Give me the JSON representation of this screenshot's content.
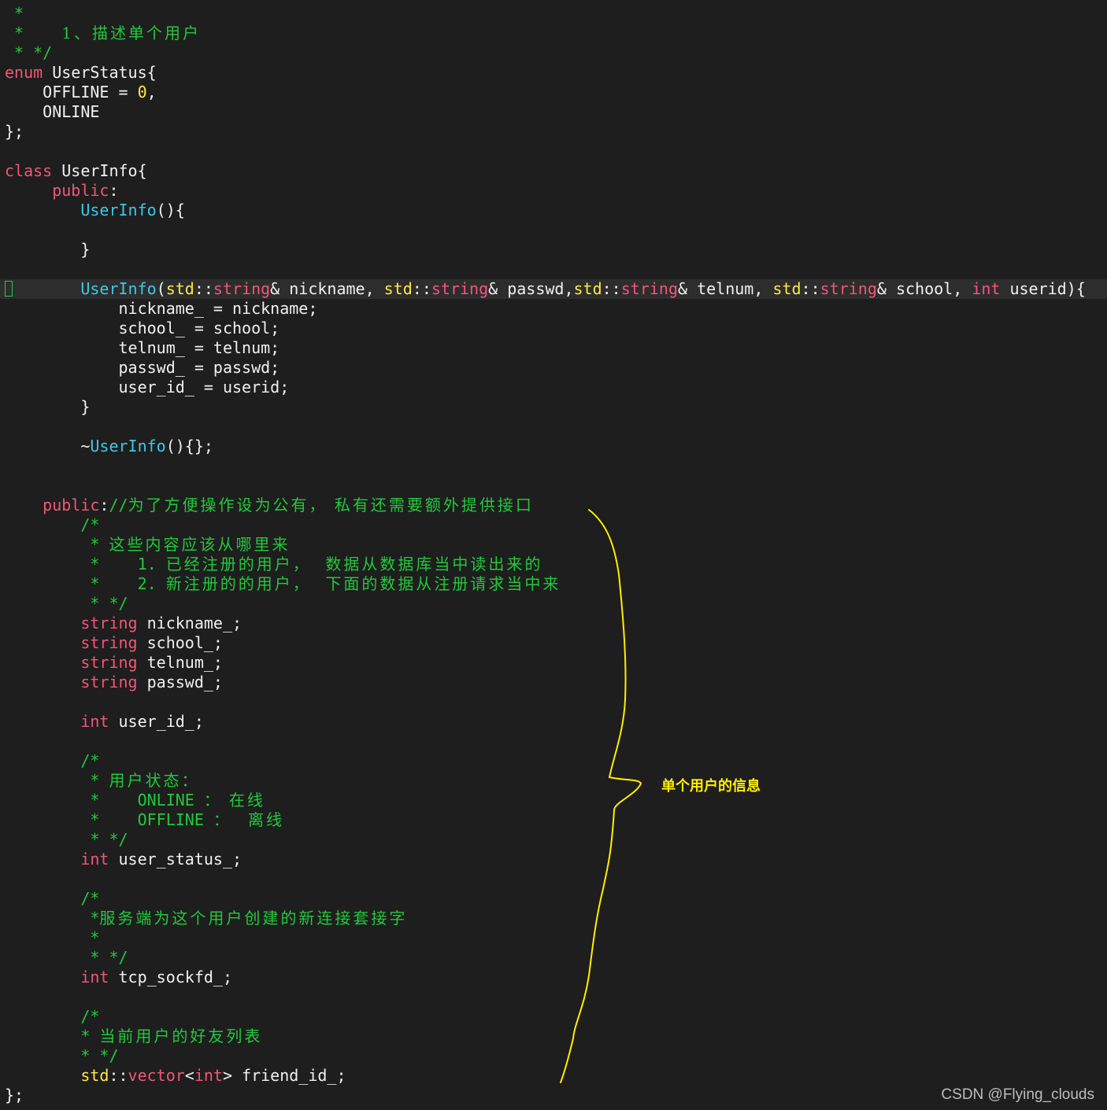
{
  "editor": {
    "lines": [
      {
        "tokens": [
          {
            "t": " *",
            "c": "cm"
          }
        ]
      },
      {
        "tokens": [
          {
            "t": " *    ",
            "c": "cm"
          },
          {
            "t": "1、描述单个用户",
            "c": "cm-cn"
          }
        ]
      },
      {
        "tokens": [
          {
            "t": " * */",
            "c": "cm"
          }
        ]
      },
      {
        "tokens": [
          {
            "t": "enum",
            "c": "kw"
          },
          {
            "t": " UserStatus{",
            "c": "plain"
          }
        ]
      },
      {
        "tokens": [
          {
            "t": "    OFFLINE = ",
            "c": "plain"
          },
          {
            "t": "0",
            "c": "num"
          },
          {
            "t": ",",
            "c": "plain"
          }
        ]
      },
      {
        "tokens": [
          {
            "t": "    ONLINE",
            "c": "plain"
          }
        ]
      },
      {
        "tokens": [
          {
            "t": "};",
            "c": "plain"
          }
        ]
      },
      {
        "tokens": []
      },
      {
        "tokens": [
          {
            "t": "class",
            "c": "kw"
          },
          {
            "t": " UserInfo{",
            "c": "plain"
          }
        ]
      },
      {
        "tokens": [
          {
            "t": "     ",
            "c": "plain"
          },
          {
            "t": "public",
            "c": "kw"
          },
          {
            "t": ":",
            "c": "plain"
          }
        ]
      },
      {
        "tokens": [
          {
            "t": "        ",
            "c": "plain"
          },
          {
            "t": "UserInfo",
            "c": "fn"
          },
          {
            "t": "(){",
            "c": "plain"
          }
        ]
      },
      {
        "tokens": []
      },
      {
        "tokens": [
          {
            "t": "        }",
            "c": "plain"
          }
        ]
      },
      {
        "tokens": []
      },
      {
        "cursor": true,
        "tokens": [
          {
            "t": "        ",
            "c": "plain"
          },
          {
            "t": "UserInfo",
            "c": "fn"
          },
          {
            "t": "(",
            "c": "plain"
          },
          {
            "t": "std",
            "c": "ns"
          },
          {
            "t": "::",
            "c": "plain"
          },
          {
            "t": "string",
            "c": "type"
          },
          {
            "t": "& nickname, ",
            "c": "plain"
          },
          {
            "t": "std",
            "c": "ns"
          },
          {
            "t": "::",
            "c": "plain"
          },
          {
            "t": "string",
            "c": "type"
          },
          {
            "t": "& passwd,",
            "c": "plain"
          },
          {
            "t": "std",
            "c": "ns"
          },
          {
            "t": "::",
            "c": "plain"
          },
          {
            "t": "string",
            "c": "type"
          },
          {
            "t": "& telnum, ",
            "c": "plain"
          },
          {
            "t": "std",
            "c": "ns"
          },
          {
            "t": "::",
            "c": "plain"
          },
          {
            "t": "string",
            "c": "type"
          },
          {
            "t": "& school, ",
            "c": "plain"
          },
          {
            "t": "int",
            "c": "kw"
          },
          {
            "t": " userid){",
            "c": "plain"
          }
        ]
      },
      {
        "tokens": [
          {
            "t": "            nickname_ = nickname;",
            "c": "plain"
          }
        ]
      },
      {
        "tokens": [
          {
            "t": "            school_ = school;",
            "c": "plain"
          }
        ]
      },
      {
        "tokens": [
          {
            "t": "            telnum_ = telnum;",
            "c": "plain"
          }
        ]
      },
      {
        "tokens": [
          {
            "t": "            passwd_ = passwd;",
            "c": "plain"
          }
        ]
      },
      {
        "tokens": [
          {
            "t": "            user_id_ = userid;",
            "c": "plain"
          }
        ]
      },
      {
        "tokens": [
          {
            "t": "        }",
            "c": "plain"
          }
        ]
      },
      {
        "tokens": []
      },
      {
        "tokens": [
          {
            "t": "        ~",
            "c": "plain"
          },
          {
            "t": "UserInfo",
            "c": "fn"
          },
          {
            "t": "(){};",
            "c": "plain"
          }
        ]
      },
      {
        "tokens": []
      },
      {
        "tokens": []
      },
      {
        "tokens": [
          {
            "t": "    ",
            "c": "plain"
          },
          {
            "t": "public",
            "c": "kw"
          },
          {
            "t": ":",
            "c": "plain"
          },
          {
            "t": "//",
            "c": "cm"
          },
          {
            "t": "为了方便操作设为公有， 私有还需要额外提供接口",
            "c": "cm-cn"
          }
        ]
      },
      {
        "tokens": [
          {
            "t": "        /*",
            "c": "cm"
          }
        ]
      },
      {
        "tokens": [
          {
            "t": "         * ",
            "c": "cm"
          },
          {
            "t": "这些内容应该从哪里来",
            "c": "cm-cn"
          }
        ]
      },
      {
        "tokens": [
          {
            "t": "         *    1. ",
            "c": "cm"
          },
          {
            "t": "已经注册的用户，  数据从数据库当中读出来的",
            "c": "cm-cn"
          }
        ]
      },
      {
        "tokens": [
          {
            "t": "         *    2. ",
            "c": "cm"
          },
          {
            "t": "新注册的的用户，  下面的数据从注册请求当中来",
            "c": "cm-cn"
          }
        ]
      },
      {
        "tokens": [
          {
            "t": "         * */",
            "c": "cm"
          }
        ]
      },
      {
        "tokens": [
          {
            "t": "        ",
            "c": "plain"
          },
          {
            "t": "string",
            "c": "type"
          },
          {
            "t": " nickname_;",
            "c": "plain"
          }
        ]
      },
      {
        "tokens": [
          {
            "t": "        ",
            "c": "plain"
          },
          {
            "t": "string",
            "c": "type"
          },
          {
            "t": " school_;",
            "c": "plain"
          }
        ]
      },
      {
        "tokens": [
          {
            "t": "        ",
            "c": "plain"
          },
          {
            "t": "string",
            "c": "type"
          },
          {
            "t": " telnum_;",
            "c": "plain"
          }
        ]
      },
      {
        "tokens": [
          {
            "t": "        ",
            "c": "plain"
          },
          {
            "t": "string",
            "c": "type"
          },
          {
            "t": " passwd_;",
            "c": "plain"
          }
        ]
      },
      {
        "tokens": []
      },
      {
        "tokens": [
          {
            "t": "        ",
            "c": "plain"
          },
          {
            "t": "int",
            "c": "kw"
          },
          {
            "t": " user_id_;",
            "c": "plain"
          }
        ]
      },
      {
        "tokens": []
      },
      {
        "tokens": [
          {
            "t": "        /*",
            "c": "cm"
          }
        ]
      },
      {
        "tokens": [
          {
            "t": "         * ",
            "c": "cm"
          },
          {
            "t": "用户状态：",
            "c": "cm-cn"
          }
        ]
      },
      {
        "tokens": [
          {
            "t": "         *    ONLINE ： ",
            "c": "cm"
          },
          {
            "t": "在线",
            "c": "cm-cn"
          }
        ]
      },
      {
        "tokens": [
          {
            "t": "         *    OFFLINE ：  ",
            "c": "cm"
          },
          {
            "t": "离线",
            "c": "cm-cn"
          }
        ]
      },
      {
        "tokens": [
          {
            "t": "         * */",
            "c": "cm"
          }
        ]
      },
      {
        "tokens": [
          {
            "t": "        ",
            "c": "plain"
          },
          {
            "t": "int",
            "c": "kw"
          },
          {
            "t": " user_status_;",
            "c": "plain"
          }
        ]
      },
      {
        "tokens": []
      },
      {
        "tokens": [
          {
            "t": "        /*",
            "c": "cm"
          }
        ]
      },
      {
        "tokens": [
          {
            "t": "         *",
            "c": "cm"
          },
          {
            "t": "服务端为这个用户创建的新连接套接字",
            "c": "cm-cn"
          }
        ]
      },
      {
        "tokens": [
          {
            "t": "         *",
            "c": "cm"
          }
        ]
      },
      {
        "tokens": [
          {
            "t": "         * */",
            "c": "cm"
          }
        ]
      },
      {
        "tokens": [
          {
            "t": "        ",
            "c": "plain"
          },
          {
            "t": "int",
            "c": "kw"
          },
          {
            "t": " tcp_sockfd_;",
            "c": "plain"
          }
        ]
      },
      {
        "tokens": []
      },
      {
        "tokens": [
          {
            "t": "        /*",
            "c": "cm"
          }
        ]
      },
      {
        "tokens": [
          {
            "t": "        * ",
            "c": "cm"
          },
          {
            "t": "当前用户的好友列表",
            "c": "cm-cn"
          }
        ]
      },
      {
        "tokens": [
          {
            "t": "        * */",
            "c": "cm"
          }
        ]
      },
      {
        "tokens": [
          {
            "t": "        ",
            "c": "plain"
          },
          {
            "t": "std",
            "c": "ns"
          },
          {
            "t": "::",
            "c": "plain"
          },
          {
            "t": "vector",
            "c": "type"
          },
          {
            "t": "<",
            "c": "plain"
          },
          {
            "t": "int",
            "c": "kw"
          },
          {
            "t": "> friend_id_;",
            "c": "plain"
          }
        ]
      },
      {
        "tokens": [
          {
            "t": "};",
            "c": "plain"
          }
        ]
      }
    ]
  },
  "annotation": {
    "label": "单个用户的信息",
    "color": "#ffee00"
  },
  "watermark": {
    "text": "CSDN @Flying_clouds"
  },
  "theme": {
    "background": "#1e1e1e",
    "keyword": "#f2557a",
    "namespace": "#ffe84a",
    "function": "#3ec8e6",
    "comment": "#24c83c",
    "number": "#ffe84a",
    "cursor": "#22c84a"
  }
}
